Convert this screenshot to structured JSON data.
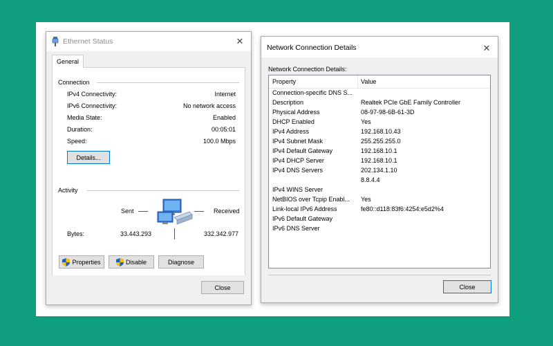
{
  "ethernet_status": {
    "title": "Ethernet Status",
    "tab": "General",
    "connection": {
      "heading": "Connection",
      "rows": [
        {
          "label": "IPv4 Connectivity:",
          "value": "Internet"
        },
        {
          "label": "IPv6 Connectivity:",
          "value": "No network access"
        },
        {
          "label": "Media State:",
          "value": "Enabled"
        },
        {
          "label": "Duration:",
          "value": "00:05:01"
        },
        {
          "label": "Speed:",
          "value": "100.0 Mbps"
        }
      ],
      "details_button": "Details..."
    },
    "activity": {
      "heading": "Activity",
      "sent_label": "Sent",
      "received_label": "Received",
      "bytes_label": "Bytes:",
      "bytes_sent": "33.443.293",
      "bytes_received": "332.342.977"
    },
    "buttons": {
      "properties": "Properties",
      "disable": "Disable",
      "diagnose": "Diagnose",
      "close": "Close"
    },
    "icons": {
      "title": "ethernet-plug-icon",
      "network": "network-computers-icon",
      "shield": "uac-shield-icon"
    }
  },
  "details": {
    "title": "Network Connection Details",
    "label": "Network Connection Details:",
    "columns": {
      "property": "Property",
      "value": "Value"
    },
    "rows": [
      {
        "property": "Connection-specific DNS S...",
        "value": ""
      },
      {
        "property": "Description",
        "value": "Realtek PCIe GbE Family Controller"
      },
      {
        "property": "Physical Address",
        "value": "08-97-98-6B-61-3D"
      },
      {
        "property": "DHCP Enabled",
        "value": "Yes"
      },
      {
        "property": "IPv4 Address",
        "value": "192.168.10.43"
      },
      {
        "property": "IPv4 Subnet Mask",
        "value": "255.255.255.0"
      },
      {
        "property": "IPv4 Default Gateway",
        "value": "192.168.10.1"
      },
      {
        "property": "IPv4 DHCP Server",
        "value": "192.168.10.1"
      },
      {
        "property": "IPv4 DNS Servers",
        "value": "202.134.1.10"
      },
      {
        "property": "",
        "value": "8.8.4.4"
      },
      {
        "property": "IPv4 WINS Server",
        "value": ""
      },
      {
        "property": "NetBIOS over Tcpip Enabl...",
        "value": "Yes"
      },
      {
        "property": "Link-local IPv6 Address",
        "value": "fe80::d118:83f6:4254:e5d2%4"
      },
      {
        "property": "IPv6 Default Gateway",
        "value": ""
      },
      {
        "property": "IPv6 DNS Server",
        "value": ""
      }
    ],
    "close_button": "Close"
  },
  "colors": {
    "background": "#0f9e7e",
    "accent_border": "#0078d7"
  }
}
